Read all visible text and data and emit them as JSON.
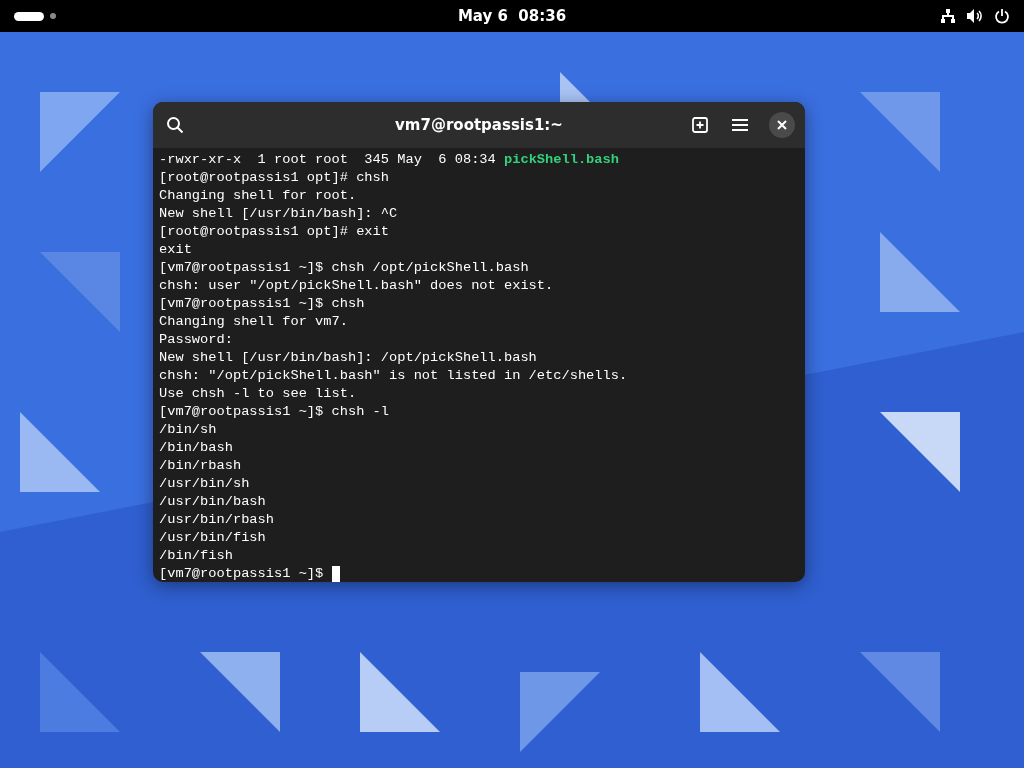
{
  "top_bar": {
    "workspaces": [
      {
        "selected": true
      },
      {
        "selected": false
      }
    ],
    "clock": "May 6  08:36"
  },
  "terminal": {
    "title": "vm7@rootpassis1:~",
    "lines": [
      {
        "text": "-rwxr-xr-x  1 root root  345 May  6 08:34 ",
        "executable": "pickShell.bash"
      },
      {
        "text": "[root@rootpassis1 opt]# chsh"
      },
      {
        "text": "Changing shell for root."
      },
      {
        "text": "New shell [/usr/bin/bash]: ^C"
      },
      {
        "text": "[root@rootpassis1 opt]# exit"
      },
      {
        "text": "exit"
      },
      {
        "text": "[vm7@rootpassis1 ~]$ chsh /opt/pickShell.bash"
      },
      {
        "text": "chsh: user \"/opt/pickShell.bash\" does not exist."
      },
      {
        "text": "[vm7@rootpassis1 ~]$ chsh"
      },
      {
        "text": "Changing shell for vm7."
      },
      {
        "text": "Password:"
      },
      {
        "text": "New shell [/usr/bin/bash]: /opt/pickShell.bash"
      },
      {
        "text": "chsh: \"/opt/pickShell.bash\" is not listed in /etc/shells."
      },
      {
        "text": "Use chsh -l to see list."
      },
      {
        "text": "[vm7@rootpassis1 ~]$ chsh -l"
      },
      {
        "text": "/bin/sh"
      },
      {
        "text": "/bin/bash"
      },
      {
        "text": "/bin/rbash"
      },
      {
        "text": "/usr/bin/sh"
      },
      {
        "text": "/usr/bin/bash"
      },
      {
        "text": "/usr/bin/rbash"
      },
      {
        "text": "/usr/bin/fish"
      },
      {
        "text": "/bin/fish"
      },
      {
        "text": "[vm7@rootpassis1 ~]$ ",
        "cursor": true
      }
    ]
  }
}
